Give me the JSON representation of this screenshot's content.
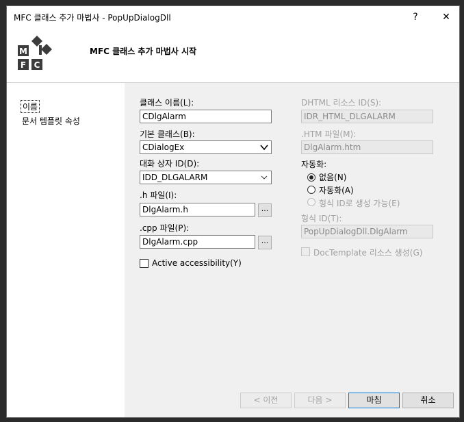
{
  "window": {
    "title": "MFC 클래스 추가 마법사 - PopUpDialogDll",
    "help_label": "?",
    "close_label": "✕"
  },
  "header": {
    "title": "MFC 클래스 추가 마법사 시작",
    "logo_letters": [
      "M",
      "F",
      "C"
    ]
  },
  "nav": {
    "items": [
      {
        "label": "이름"
      },
      {
        "label": "문서 템플릿 속성"
      }
    ]
  },
  "form": {
    "class_name": {
      "label": "클래스 이름(L):",
      "value": "CDlgAlarm"
    },
    "base_class": {
      "label": "기본 클래스(B):",
      "value": "CDialogEx"
    },
    "dialog_id": {
      "label": "대화 상자 ID(D):",
      "value": "IDD_DLGALARM"
    },
    "h_file": {
      "label": ".h 파일(I):",
      "value": "DlgAlarm.h",
      "browse": "..."
    },
    "cpp_file": {
      "label": ".cpp 파일(P):",
      "value": "DlgAlarm.cpp",
      "browse": "..."
    },
    "active_accessibility": {
      "label": "Active accessibility(Y)",
      "checked": false
    },
    "dhtml_id": {
      "label": "DHTML 리소스 ID(S):",
      "value": "IDR_HTML_DLGALARM"
    },
    "htm_file": {
      "label": ".HTM 파일(M):",
      "value": "DlgAlarm.htm"
    },
    "automation": {
      "label": "자동화:",
      "options": [
        {
          "label": "없음(N)",
          "selected": true,
          "enabled": true
        },
        {
          "label": "자동화(A)",
          "selected": false,
          "enabled": true
        },
        {
          "label": "형식 ID로 생성 가능(E)",
          "selected": false,
          "enabled": false
        }
      ]
    },
    "type_id": {
      "label": "형식 ID(T):",
      "value": "PopUpDialogDll.DlgAlarm"
    },
    "doctemplate": {
      "label": "DocTemplate 리소스 생성(G)",
      "checked": false
    }
  },
  "buttons": {
    "prev": "< 이전",
    "next": "다음 >",
    "finish": "마침",
    "cancel": "취소"
  },
  "colors": {
    "focus_border": "#0078d7",
    "window_bg": "#f0f0f0"
  }
}
